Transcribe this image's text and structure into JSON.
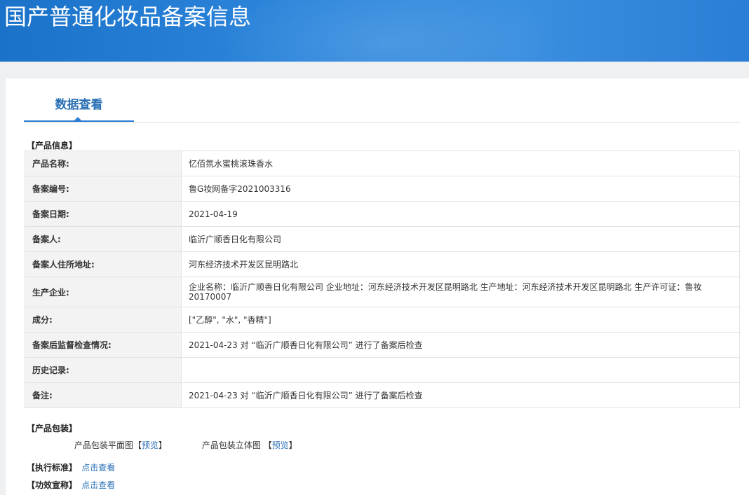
{
  "header": {
    "title": "国产普通化妆品备案信息"
  },
  "tabs": [
    {
      "label": "数据查看"
    }
  ],
  "product_info": {
    "section_label": "【产品信息】",
    "rows": [
      {
        "key": "产品名称:",
        "value": "忆佰氛水蜜桃滚珠香水"
      },
      {
        "key": "备案编号:",
        "value": "鲁G妆网备字2021003316"
      },
      {
        "key": "备案日期:",
        "value": "2021-04-19"
      },
      {
        "key": "备案人:",
        "value": "临沂广顺香日化有限公司"
      },
      {
        "key": "备案人住所地址:",
        "value": "河东经济技术开发区昆明路北"
      },
      {
        "key": "生产企业:",
        "value": "企业名称：临沂广顺香日化有限公司 企业地址：河东经济技术开发区昆明路北 生产地址：河东经济技术开发区昆明路北 生产许可证：鲁妆20170007"
      },
      {
        "key": "成分:",
        "value": "[\"乙醇\", \"水\", \"香精\"]"
      },
      {
        "key": "备案后监督检查情况:",
        "value": "2021-04-23 对 “临沂广顺香日化有限公司” 进行了备案后检查"
      },
      {
        "key": "历史记录:",
        "value": ""
      },
      {
        "key": "备注:",
        "value": "2021-04-23 对 “临沂广顺香日化有限公司” 进行了备案后检查"
      }
    ]
  },
  "packaging": {
    "section_label": "【产品包装】",
    "flat_label": "产品包装平面图",
    "threed_label": "产品包装立体图",
    "bracket_open": "【",
    "bracket_close": "】",
    "preview_label": "预览"
  },
  "standard": {
    "section_label": "【执行标准】",
    "link": "点击查看"
  },
  "efficacy": {
    "section_label": "【功效宣称】",
    "link": "点击查看"
  }
}
